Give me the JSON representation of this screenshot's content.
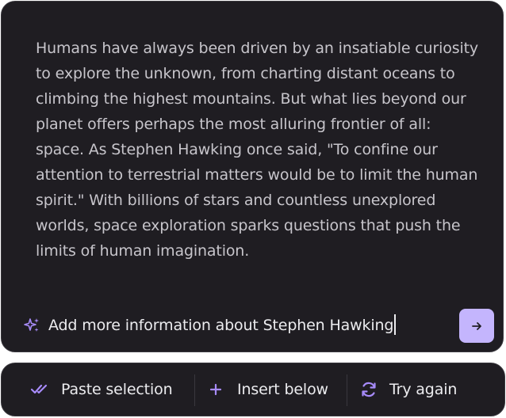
{
  "editor": {
    "paragraph": "Humans have always been driven by an insatiable curiosity to explore the unknown, from charting distant oceans to climbing the highest mountains. But what lies beyond our planet offers perhaps the most alluring frontier of all: space. As Stephen Hawking once said, \"To confine our attention to terrestrial matters would be to limit the human spirit.\" With billions of stars and countless unexplored worlds, space exploration sparks questions that push the limits of human imagination."
  },
  "prompt": {
    "value": "Add more information about Stephen Hawking",
    "icon": "sparkles-icon",
    "send_icon": "arrow-right-icon"
  },
  "toolbar": {
    "paste_selection_label": "Paste selection",
    "insert_below_label": "Insert below",
    "try_again_label": "Try again"
  },
  "colors": {
    "panel_bg": "#1f1d22",
    "panel_border": "#3a383e",
    "body_text": "#c7c5cb",
    "accent": "#c4b5fd",
    "icon_accent": "#a78bfa"
  }
}
